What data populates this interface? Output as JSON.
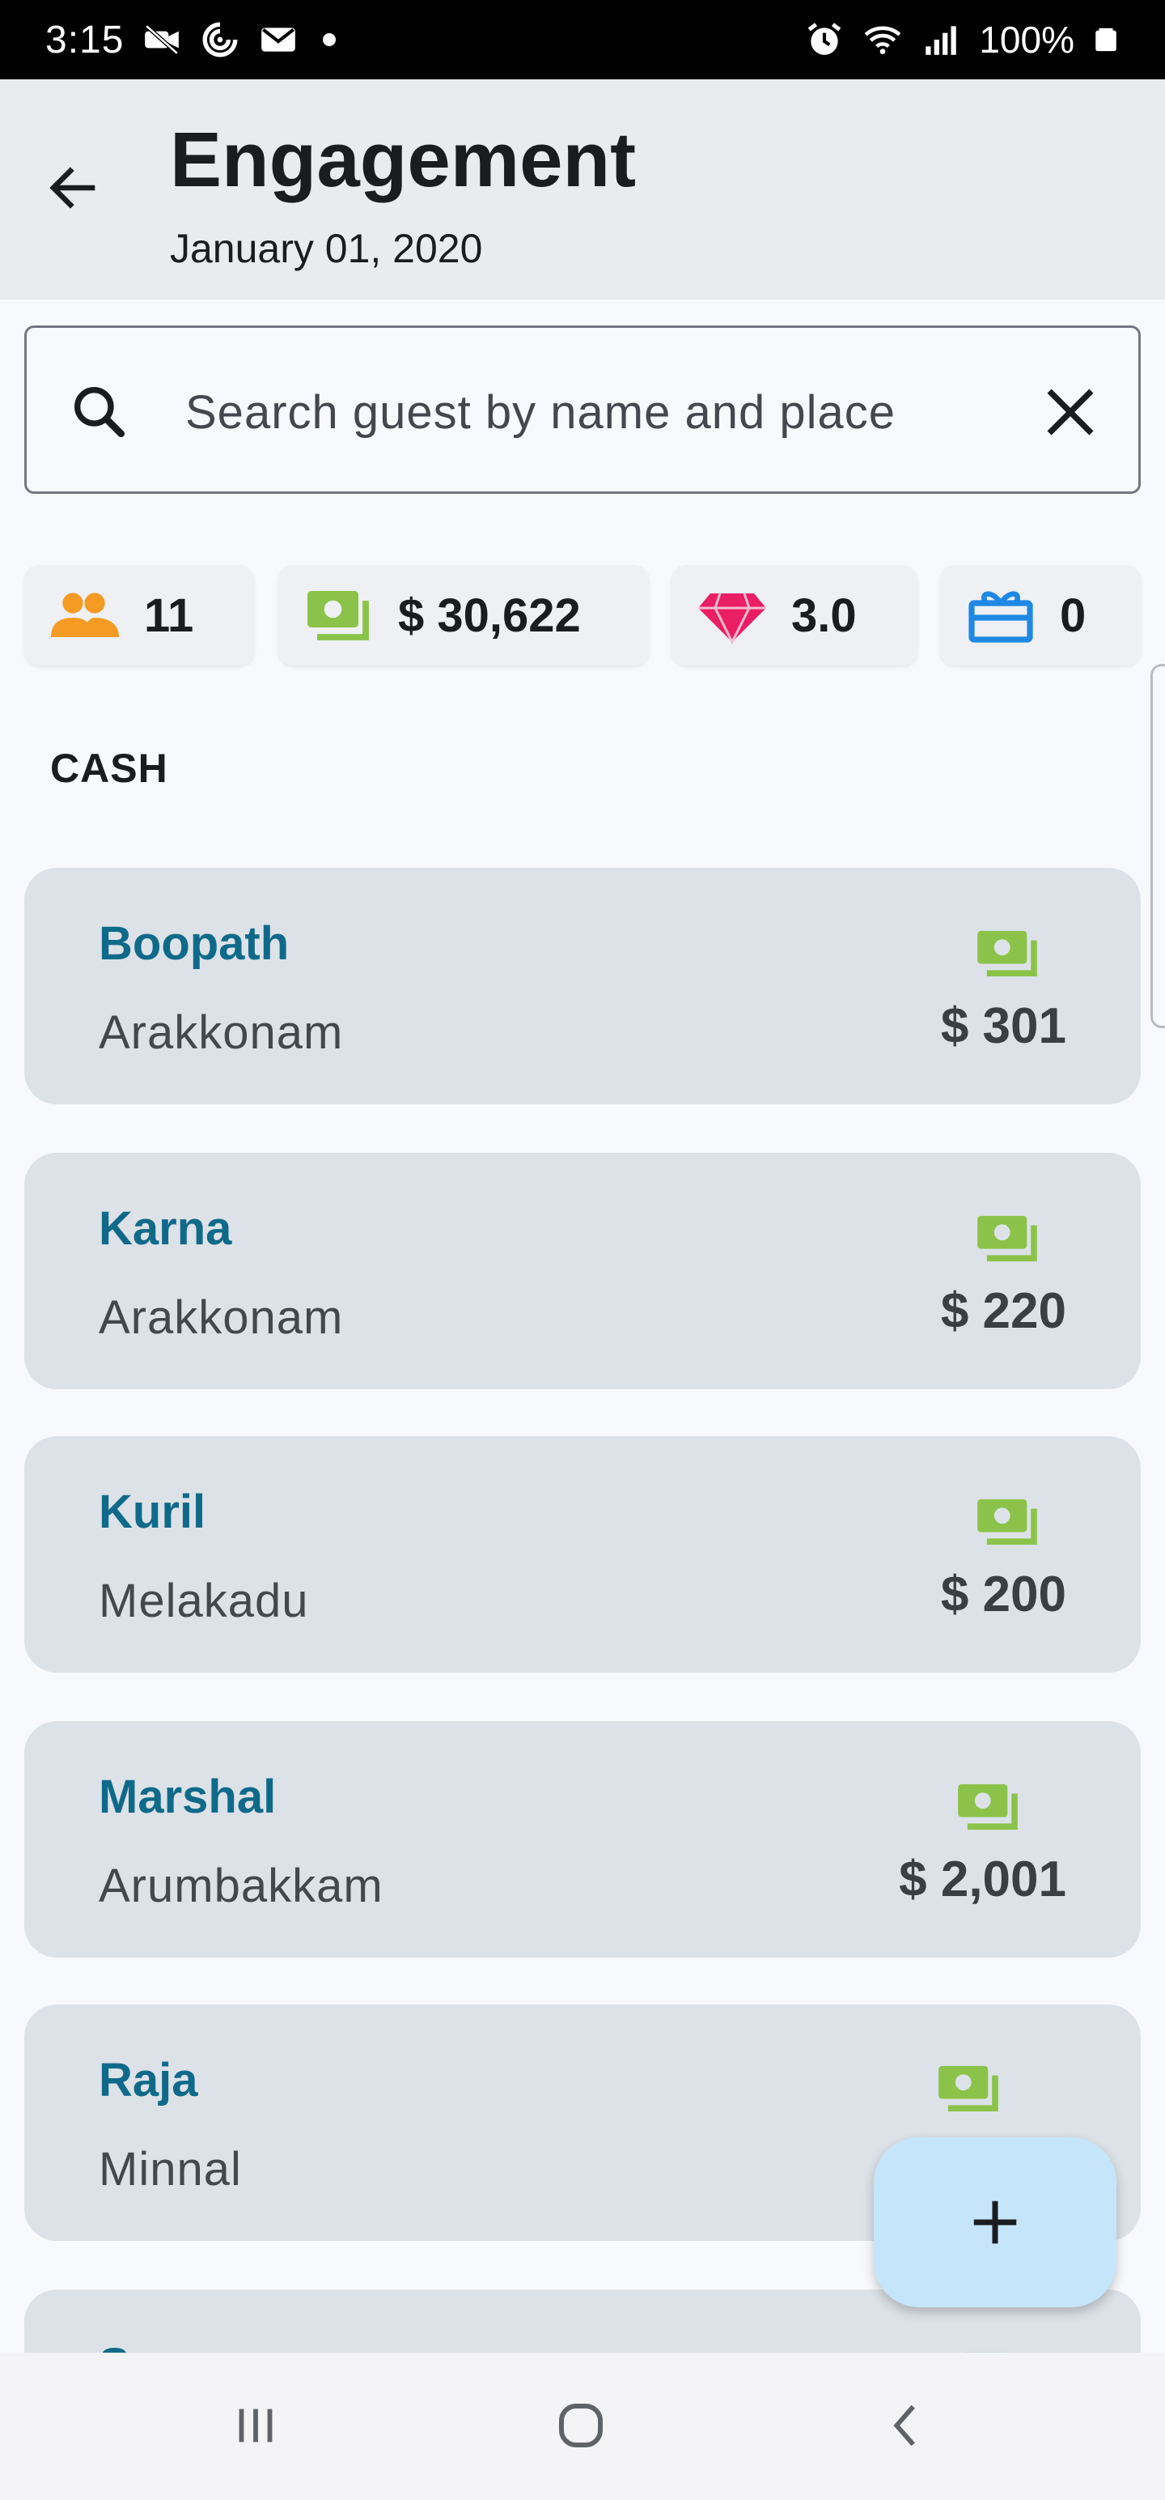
{
  "status_bar": {
    "time": "3:15",
    "battery": "100%",
    "icons": [
      "video-off-icon",
      "sync-icon",
      "mail-icon",
      "dot-icon",
      "alarm-icon",
      "wifi-icon",
      "signal-icon",
      "battery-icon"
    ]
  },
  "header": {
    "title": "Engagement",
    "subtitle": "January 01, 2020",
    "back_icon": "arrow-left-icon"
  },
  "search": {
    "placeholder": "Search guest by name and place",
    "value": "",
    "search_icon": "search-icon",
    "clear_icon": "close-icon"
  },
  "stats": [
    {
      "icon": "people-icon",
      "value": "11",
      "color": "#F59A23"
    },
    {
      "icon": "cash-icon",
      "value": "$ 30,622",
      "color": "#7CB342"
    },
    {
      "icon": "diamond-icon",
      "value": "3.0",
      "color": "#E91E63"
    },
    {
      "icon": "gift-icon",
      "value": "0",
      "color": "#1E88E5"
    }
  ],
  "section": {
    "label": "CASH"
  },
  "guests": [
    {
      "name": "Boopath",
      "place": "Arakkonam",
      "amount": "$ 301"
    },
    {
      "name": "Karna",
      "place": "Arakkonam",
      "amount": "$ 220"
    },
    {
      "name": "Kuril",
      "place": "Melakadu",
      "amount": "$ 200"
    },
    {
      "name": "Marshal",
      "place": "Arumbakkam",
      "amount": "$ 2,001"
    },
    {
      "name": "Raja",
      "place": "Minnal",
      "amount": "$"
    },
    {
      "name": "S",
      "place": "",
      "amount": ""
    }
  ],
  "colors": {
    "accent_name": "#0F6A8A",
    "cash_green": "#8BC34A",
    "fab_bg": "#C5E6FA",
    "card_bg": "#DDE2E8"
  },
  "fab": {
    "icon": "plus-icon"
  },
  "nav_bar": {
    "icons": [
      "recent-apps-icon",
      "home-icon",
      "back-icon"
    ]
  }
}
